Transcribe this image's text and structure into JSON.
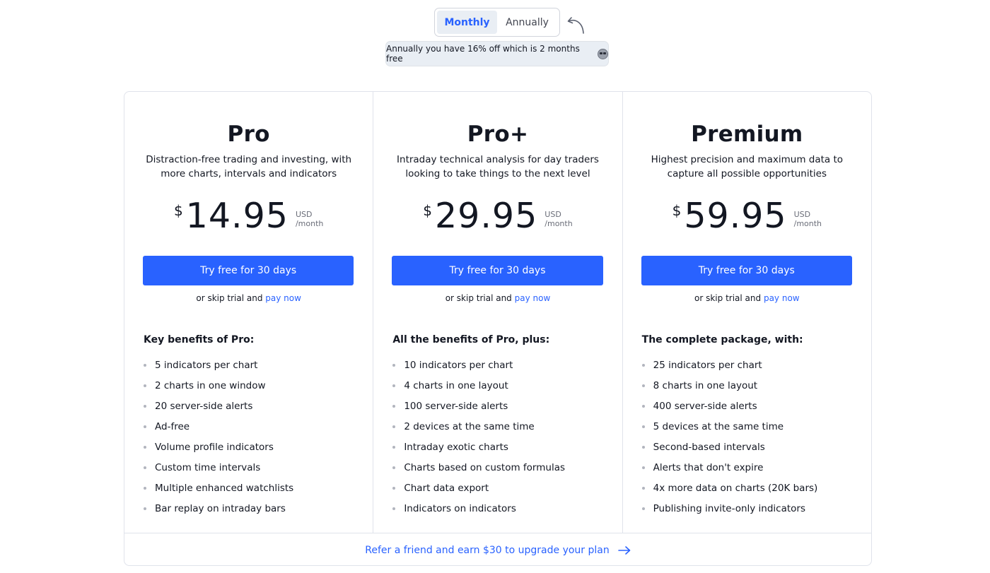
{
  "billing": {
    "options": [
      "Monthly",
      "Annually"
    ],
    "selected": "Monthly",
    "discount_note": "Annually you have 16% off which is 2 months free"
  },
  "plans": [
    {
      "name": "Pro",
      "description": "Distraction-free trading and investing, with more charts, intervals and indicators",
      "currency_symbol": "$",
      "price": "14.95",
      "currency": "USD",
      "period": "/month",
      "cta": "Try free for 30 days",
      "skip_text": "or skip trial and",
      "pay_now": "pay now",
      "benefits_title": "Key benefits of Pro:",
      "benefits": [
        "5 indicators per chart",
        "2 charts in one window",
        "20 server-side alerts",
        "Ad-free",
        "Volume profile indicators",
        "Custom time intervals",
        "Multiple enhanced watchlists",
        "Bar replay on intraday bars"
      ]
    },
    {
      "name": "Pro+",
      "description": "Intraday technical analysis for day traders looking to take things to the next level",
      "currency_symbol": "$",
      "price": "29.95",
      "currency": "USD",
      "period": "/month",
      "cta": "Try free for 30 days",
      "skip_text": "or skip trial and",
      "pay_now": "pay now",
      "benefits_title": "All the benefits of Pro, plus:",
      "benefits": [
        "10 indicators per chart",
        "4 charts in one layout",
        "100 server-side alerts",
        "2 devices at the same time",
        "Intraday exotic charts",
        "Charts based on custom formulas",
        "Chart data export",
        "Indicators on indicators"
      ]
    },
    {
      "name": "Premium",
      "description": "Highest precision and maximum data to capture all possible opportunities",
      "currency_symbol": "$",
      "price": "59.95",
      "currency": "USD",
      "period": "/month",
      "cta": "Try free for 30 days",
      "skip_text": "or skip trial and",
      "pay_now": "pay now",
      "benefits_title": "The complete package, with:",
      "benefits": [
        "25 indicators per chart",
        "8 charts in one layout",
        "400 server-side alerts",
        "5 devices at the same time",
        "Second-based intervals",
        "Alerts that don't expire",
        "4x more data on charts (20K bars)",
        "Publishing invite-only indicators"
      ]
    }
  ],
  "referral": {
    "text": "Refer a friend and earn $30 to upgrade your plan"
  },
  "colors": {
    "accent": "#2962ff",
    "text": "#131722",
    "border": "#e0e3eb",
    "toggle_active_bg": "#e9eef4"
  },
  "icons": [
    "curved-arrow-icon",
    "smirk-emoji-icon",
    "arrow-right-icon"
  ]
}
